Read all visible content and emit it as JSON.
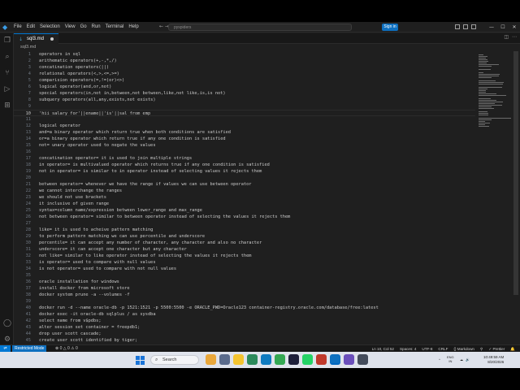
{
  "window": {
    "menu": [
      "File",
      "Edit",
      "Selection",
      "View",
      "Go",
      "Run",
      "Terminal",
      "Help"
    ],
    "nav_arrows": "← →",
    "search_text": "pyspiders",
    "signin_label": "Sign in"
  },
  "tab": {
    "label": "sql3.md",
    "icon": "markdown-icon"
  },
  "breadcrumb": "sql3.md",
  "editor_lines": [
    {
      "n": "1",
      "text": "operators in sql"
    },
    {
      "n": "2",
      "text": "arithematic operators(+,-,*,/)"
    },
    {
      "n": "3",
      "text": "concatination operators(||)"
    },
    {
      "n": "4",
      "text": "relational operators(<,>,<=,>=)"
    },
    {
      "n": "5",
      "text": "comparision operators(=,!=(or)<>)"
    },
    {
      "n": "6",
      "text": "logical operator(and,or,not)"
    },
    {
      "n": "7",
      "text": "special operators(in,not in,between,not between,like,not like,is,is not)"
    },
    {
      "n": "8",
      "text": "subquery operators(all,any,exists,not exists)"
    },
    {
      "n": "9",
      "text": ""
    },
    {
      "n": "10",
      "text": "'hii salary for'||ename||'is'||sal from emp"
    },
    {
      "n": "11",
      "text": ""
    },
    {
      "n": "12",
      "text": "logical operator"
    },
    {
      "n": "13",
      "text": "and=a binary operator which return true when both conditions are satisfied"
    },
    {
      "n": "14",
      "text": "or=a binary operator which return true if any one condition is satisfied"
    },
    {
      "n": "15",
      "text": "not= unary operator used to negate the values"
    },
    {
      "n": "16",
      "text": ""
    },
    {
      "n": "17",
      "text": "concatination operator= it is used to join multiple strings"
    },
    {
      "n": "18",
      "text": "in operator= is multivalued operator which returns true if any one condition is satisfied"
    },
    {
      "n": "19",
      "text": "not in operator= is similar to in operator instead of selecting values it rejects them"
    },
    {
      "n": "20",
      "text": ""
    },
    {
      "n": "21",
      "text": "between operator= whenever we have the range if values we can use between operator"
    },
    {
      "n": "22",
      "text": "we cannot interchange the ranges"
    },
    {
      "n": "23",
      "text": "we should not use brackets"
    },
    {
      "n": "24",
      "text": "it inclusive of given range"
    },
    {
      "n": "25",
      "text": "syntax=column name/expression between lower_range and max_range"
    },
    {
      "n": "26",
      "text": "not between operator= similar to between operator instead of selecting the values it rejects them"
    },
    {
      "n": "27",
      "text": ""
    },
    {
      "n": "28",
      "text": "like= it is used to acheive pattern matching"
    },
    {
      "n": "29",
      "text": "to perform pattern matching we can use percentile and underscore"
    },
    {
      "n": "30",
      "text": "percentile= it can accept any number of character, any character and also no character"
    },
    {
      "n": "31",
      "text": "underscore= it can accept one character but any character"
    },
    {
      "n": "32",
      "text": "not like= similar to like operator instead of selecting the values it rejects them"
    },
    {
      "n": "33",
      "text": "is operator= used to compare with null values"
    },
    {
      "n": "34",
      "text": "is not operator= used to compare with not null values"
    },
    {
      "n": "35",
      "text": ""
    },
    {
      "n": "36",
      "text": "oracle installation for windows"
    },
    {
      "n": "37",
      "text": "install docker from microsoft store"
    },
    {
      "n": "38",
      "text": "docker system prune -a --volumes -f"
    },
    {
      "n": "39",
      "text": ""
    },
    {
      "n": "40",
      "text": "docker run -d --name oracle-db -p 1521:1521 -p 5500:5500 -e ORACLE_PWD=Oracle123 container-registry.oracle.com/database/free:latest"
    },
    {
      "n": "41",
      "text": "docker exec -it oracle-db sqlplus / as sysdba"
    },
    {
      "n": "42",
      "text": "select name from v$pdbs;"
    },
    {
      "n": "43",
      "text": "alter session set container = freepdb1;"
    },
    {
      "n": "44",
      "text": "drop user scott cascade;"
    },
    {
      "n": "45",
      "text": "create user scott identified by tiger;"
    }
  ],
  "status": {
    "restricted": "Restricted Mode",
    "problems": "⊗ 0 △ 0 ⚠ 0",
    "right": [
      "Ln 10, Col 52",
      "Spaces: 4",
      "UTF-8",
      "CRLF",
      "{} Markdown",
      "⚲",
      "✓ Prettier",
      "🔔"
    ]
  },
  "taskbar": {
    "search_label": "Search",
    "tray": [
      "^",
      "☁",
      "🔊"
    ],
    "lang": [
      "ENG",
      "IN"
    ],
    "time": "10:49:59 AM",
    "date": "8/20/2026"
  }
}
